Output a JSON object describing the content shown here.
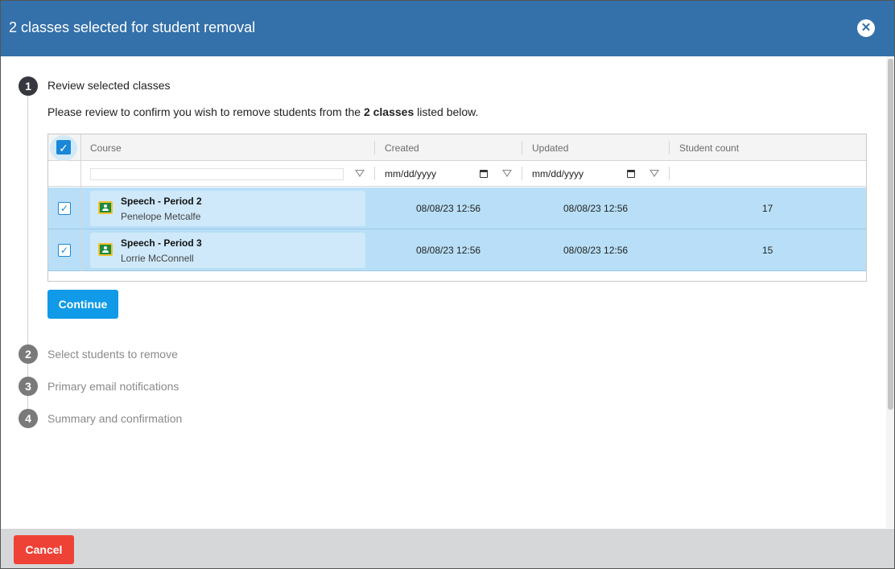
{
  "dialog": {
    "title": "2 classes selected for student removal",
    "close_icon": "close-icon",
    "close_glyph": "✕"
  },
  "steps": [
    {
      "number": "1",
      "label": "Review selected classes",
      "state": "active"
    },
    {
      "number": "2",
      "label": "Select students to remove",
      "state": "inactive"
    },
    {
      "number": "3",
      "label": "Primary email notifications",
      "state": "inactive"
    },
    {
      "number": "4",
      "label": "Summary and confirmation",
      "state": "inactive"
    }
  ],
  "review": {
    "description_pre": "Please review to confirm you wish to remove students from the ",
    "description_bold": "2 classes",
    "description_post": " listed below."
  },
  "grid": {
    "select_all_checked": true,
    "columns": [
      "Course",
      "Created",
      "Updated",
      "Student count"
    ],
    "filters": {
      "course_value": "",
      "created_placeholder": "mm/dd/yyyy",
      "updated_placeholder": "mm/dd/yyyy"
    },
    "rows": [
      {
        "checked": true,
        "course": "Speech - Period 2",
        "teacher": "Penelope Metcalfe",
        "created": "08/08/23 12:56",
        "updated": "08/08/23 12:56",
        "student_count": "17"
      },
      {
        "checked": true,
        "course": "Speech - Period 3",
        "teacher": "Lorrie McConnell",
        "created": "08/08/23 12:56",
        "updated": "08/08/23 12:56",
        "student_count": "15"
      }
    ]
  },
  "buttons": {
    "continue": "Continue",
    "cancel": "Cancel"
  },
  "icons": {
    "checkmark": "✓",
    "filter": "filter-icon",
    "calendar": "calendar-icon",
    "classroom": "google-classroom-icon"
  },
  "colors": {
    "header": "#3470a9",
    "primary_button": "#109ae8",
    "cancel_button": "#ee4236",
    "selected_row": "#b8dff7"
  }
}
